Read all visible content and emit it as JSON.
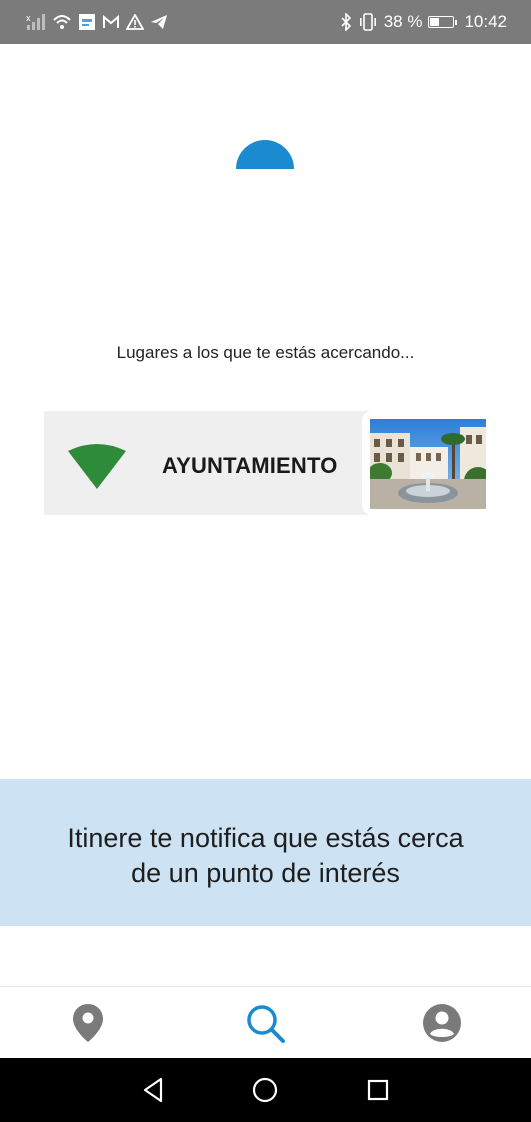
{
  "status_bar": {
    "battery_percent": "38 %",
    "time": "10:42",
    "icons_left": [
      "signal-icon",
      "wifi-icon",
      "app-notification-icon",
      "gmail-icon",
      "warning-icon",
      "telegram-icon"
    ],
    "icons_right": [
      "bluetooth-icon",
      "vibrate-icon",
      "battery-icon"
    ]
  },
  "main": {
    "approach_text": "Lugares a los que te estás acercando...",
    "poi_card": {
      "name": "AYUNTAMIENTO",
      "signal_color": "#2e8b3a"
    }
  },
  "banner": {
    "line1": "Itinere te notifica que estás cerca",
    "line2": "de un punto de interés"
  },
  "bottom_nav": {
    "items": [
      "map-pin-icon",
      "search-icon",
      "profile-icon"
    ],
    "active_color": "#1a8ad1",
    "inactive_color": "#7a7a7a"
  },
  "colors": {
    "accent": "#1a8ad1",
    "banner_bg": "#cde2f2",
    "card_bg": "#efefef"
  }
}
